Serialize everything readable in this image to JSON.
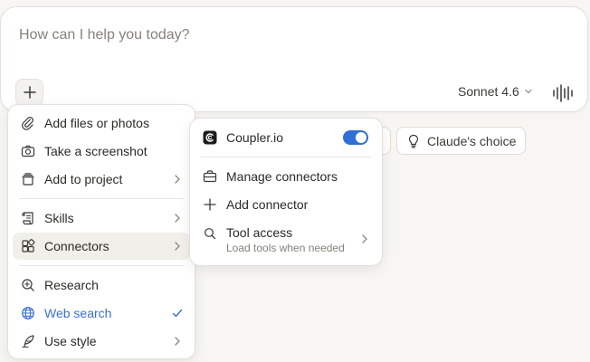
{
  "prompt": {
    "placeholder": "How can I help you today?"
  },
  "toolbar": {
    "model_label": "Sonnet 4.6"
  },
  "suggestions": {
    "claudes_choice": "Claude's choice"
  },
  "menu": {
    "items": [
      {
        "label": "Add files or photos",
        "icon": "paperclip-icon"
      },
      {
        "label": "Take a screenshot",
        "icon": "camera-icon"
      },
      {
        "label": "Add to project",
        "icon": "project-box-icon",
        "submenu": true
      },
      {
        "label": "Skills",
        "icon": "skills-scroll-icon",
        "submenu": true
      },
      {
        "label": "Connectors",
        "icon": "connectors-grid-icon",
        "submenu": true,
        "active": true
      },
      {
        "label": "Research",
        "icon": "research-magnifier-icon"
      },
      {
        "label": "Web search",
        "icon": "globe-icon",
        "checked": true
      },
      {
        "label": "Use style",
        "icon": "feather-pen-icon",
        "submenu": true
      }
    ]
  },
  "connectors_menu": {
    "coupler": {
      "label": "Coupler.io",
      "enabled": true
    },
    "manage": {
      "label": "Manage connectors"
    },
    "add": {
      "label": "Add connector"
    },
    "tool_access": {
      "label": "Tool access",
      "description": "Load tools when needed"
    }
  },
  "colors": {
    "accent": "#2f6fd6",
    "link": "#3a6fcf",
    "background": "#f7f6f2"
  }
}
